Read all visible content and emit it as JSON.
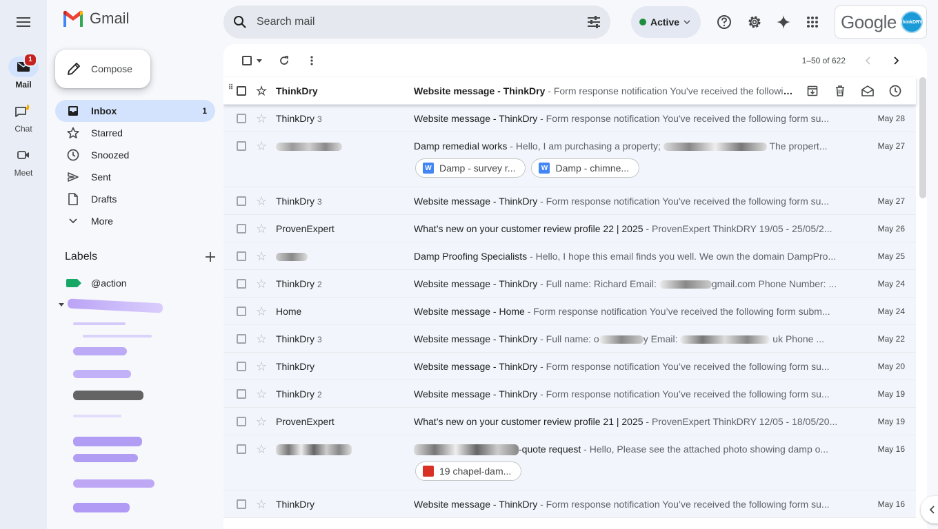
{
  "app": {
    "name": "Gmail"
  },
  "rail": {
    "items": [
      {
        "label": "Mail",
        "badge": "1"
      },
      {
        "label": "Chat"
      },
      {
        "label": "Meet"
      }
    ]
  },
  "search": {
    "placeholder": "Search mail"
  },
  "status": {
    "label": "Active"
  },
  "account": {
    "brand": "Google",
    "avatar_text": "thinkDRY"
  },
  "compose": {
    "label": "Compose"
  },
  "nav": {
    "items": [
      {
        "label": "Inbox",
        "count": "1"
      },
      {
        "label": "Starred"
      },
      {
        "label": "Snoozed"
      },
      {
        "label": "Sent"
      },
      {
        "label": "Drafts"
      },
      {
        "label": "More"
      }
    ]
  },
  "labels": {
    "heading": "Labels",
    "items": [
      {
        "label": "@action",
        "color": "#16a765"
      }
    ]
  },
  "pager": {
    "range": "1–50 of 622"
  },
  "emails": [
    {
      "sender": "ThinkDry",
      "count": "",
      "subject": "Website message - ThinkDry",
      "snippet": " - Form response notification You've received the following form submission",
      "date": "",
      "unread": true
    },
    {
      "sender": "ThinkDry",
      "count": "3",
      "subject": "Website message - ThinkDry",
      "snippet": " - Form response notification You've received the following form su...",
      "date": "May 28"
    },
    {
      "sender": "",
      "count": "",
      "subject": "Damp remedial works",
      "snippet": " - Hello, I am purchasing a property;",
      "snippet2": " The propert...",
      "date": "May 27",
      "attachments": [
        "Damp - survey r...",
        "Damp - chimne..."
      ]
    },
    {
      "sender": "ThinkDry",
      "count": "3",
      "subject": "Website message - ThinkDry",
      "snippet": " - Form response notification You've received the following form su...",
      "date": "May 27"
    },
    {
      "sender": "ProvenExpert",
      "count": "",
      "subject": "What’s new on your customer review profile 22 | 2025",
      "snippet": " - ProvenExpert ThinkDRY 19/05 - 25/05/2...",
      "date": "May 26"
    },
    {
      "sender": "",
      "count": "",
      "subject": "Damp Proofing Specialists",
      "snippet": " - Hello, I hope this email finds you well. We own the domain DampPro...",
      "date": "May 25"
    },
    {
      "sender": "ThinkDry",
      "count": "2",
      "subject": "Website message - ThinkDry",
      "snippet": " - Full name: Richard Email:",
      "snippet2": "gmail.com Phone Number: ...",
      "date": "May 24"
    },
    {
      "sender": "Home",
      "count": "",
      "subject": "Website message - Home",
      "snippet": " - Form response notification You’ve received the following form subm...",
      "date": "May 24"
    },
    {
      "sender": "ThinkDry",
      "count": "3",
      "subject": "Website message - ThinkDry",
      "snippet": " - Full name: o",
      "snippet2": "y Email:",
      "snippet3": "uk Phone ...",
      "date": "May 22"
    },
    {
      "sender": "ThinkDry",
      "count": "",
      "subject": "Website message - ThinkDry",
      "snippet": " - Form response notification You’ve received the following form su...",
      "date": "May 20"
    },
    {
      "sender": "ThinkDry",
      "count": "2",
      "subject": "Website message - ThinkDry",
      "snippet": " - Form response notification You’ve received the following form su...",
      "date": "May 19"
    },
    {
      "sender": "ProvenExpert",
      "count": "",
      "subject": "What’s new on your customer review profile 21 | 2025",
      "snippet": " - ProvenExpert ThinkDRY 12/05 - 18/05/20...",
      "date": "May 19"
    },
    {
      "sender": "",
      "count": "",
      "subject": "-quote request",
      "snippet": " - Hello, Please see the attached photo showing damp o...",
      "date": "May 16",
      "attachments": [
        "19 chapel-dam..."
      ]
    },
    {
      "sender": "ThinkDry",
      "count": "",
      "subject": "Website message - ThinkDry",
      "snippet": " - Form response notification You’ve received the following form su...",
      "date": "May 16"
    }
  ]
}
